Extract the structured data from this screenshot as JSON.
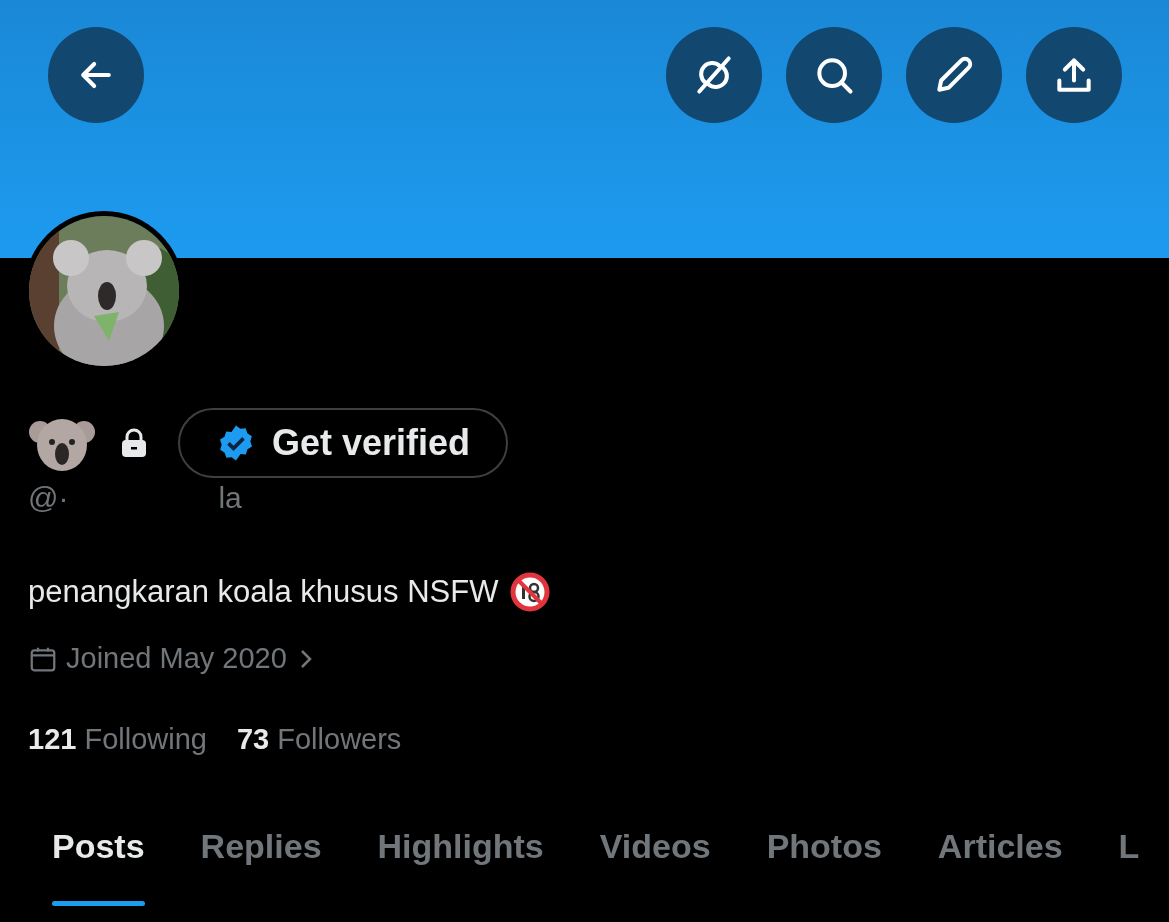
{
  "header": {
    "buttons": [
      {
        "kind": "back"
      },
      {
        "kind": "grok"
      },
      {
        "kind": "search"
      },
      {
        "kind": "edit"
      },
      {
        "kind": "share"
      }
    ]
  },
  "profile": {
    "verify_button": "Get verified",
    "handle": [
      "@·",
      "la"
    ],
    "bio": "penangkaran koala khusus NSFW",
    "joined": "Joined May 2020",
    "stats": [
      {
        "count": "121",
        "label": "Following"
      },
      {
        "count": "73",
        "label": "Followers"
      }
    ]
  },
  "tabs": [
    {
      "label": "Posts",
      "selected": true
    },
    {
      "label": "Replies",
      "selected": false
    },
    {
      "label": "Highlights",
      "selected": false
    },
    {
      "label": "Videos",
      "selected": false
    },
    {
      "label": "Photos",
      "selected": false
    },
    {
      "label": "Articles",
      "selected": false
    },
    {
      "label": "L",
      "selected": false
    }
  ]
}
